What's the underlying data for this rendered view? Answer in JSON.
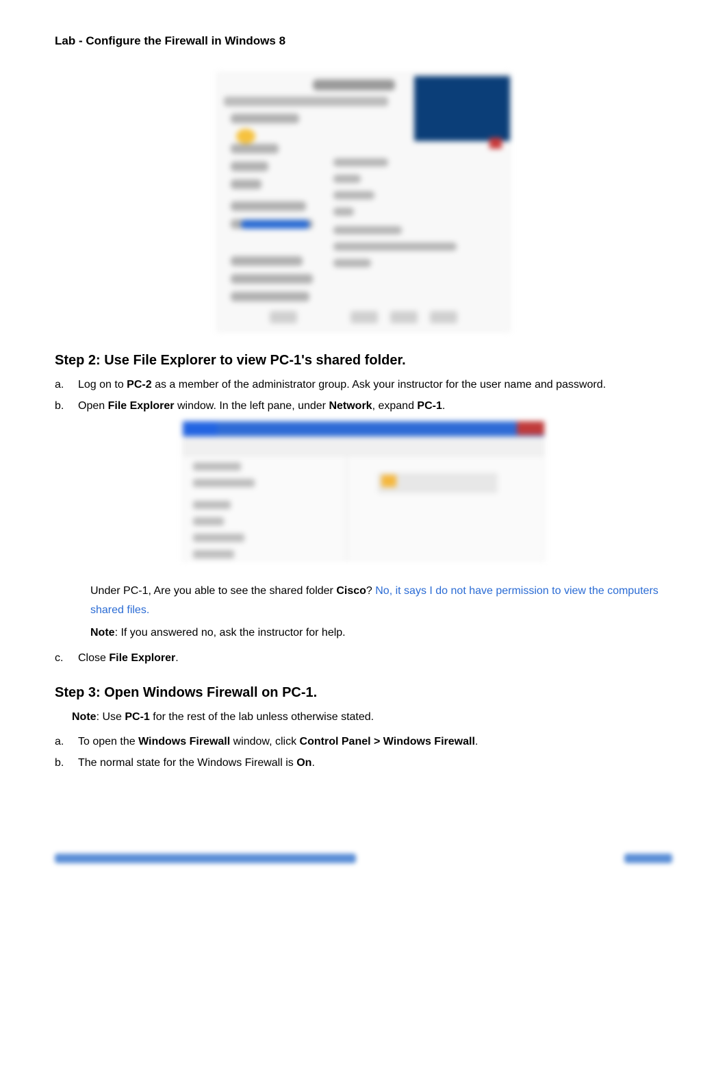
{
  "header": {
    "title": "Lab - Configure the Firewall in Windows 8"
  },
  "step2": {
    "heading": "Step 2: Use File Explorer to view PC-1's shared folder.",
    "item_a": {
      "letter": "a.",
      "pre": "Log on to ",
      "bold1": "PC-2",
      "post": " as a member of the administrator group. Ask your instructor for the user name and password."
    },
    "item_b": {
      "letter": "b.",
      "t1": "Open ",
      "b1": "File Explorer",
      "t2": " window. In the left pane, under ",
      "b2": "Network",
      "t3": ", expand ",
      "b3": "PC-1",
      "t4": "."
    },
    "question": {
      "pre": "Under PC-1, Are you able to see the shared folder ",
      "bold": "Cisco",
      "q": "?  ",
      "answer": "No, it says I do not have permission to view the computers shared files."
    },
    "note": {
      "label": "Note",
      "text": ": If you answered no, ask the instructor for help."
    },
    "item_c": {
      "letter": "c.",
      "t1": "Close ",
      "b1": "File Explorer",
      "t2": "."
    }
  },
  "step3": {
    "heading": "Step 3: Open Windows Firewall on PC-1.",
    "note": {
      "label": "Note",
      "t1": ": Use ",
      "b1": "PC-1",
      "t2": " for the rest of the lab unless otherwise stated."
    },
    "item_a": {
      "letter": "a.",
      "t1": "To open the ",
      "b1": "Windows Firewall",
      "t2": " window, click ",
      "b2": "Control Panel > Windows Firewall",
      "t3": "."
    },
    "item_b": {
      "letter": "b.",
      "t1": "The normal state for the Windows Firewall is ",
      "b1": "On",
      "t2": "."
    }
  }
}
